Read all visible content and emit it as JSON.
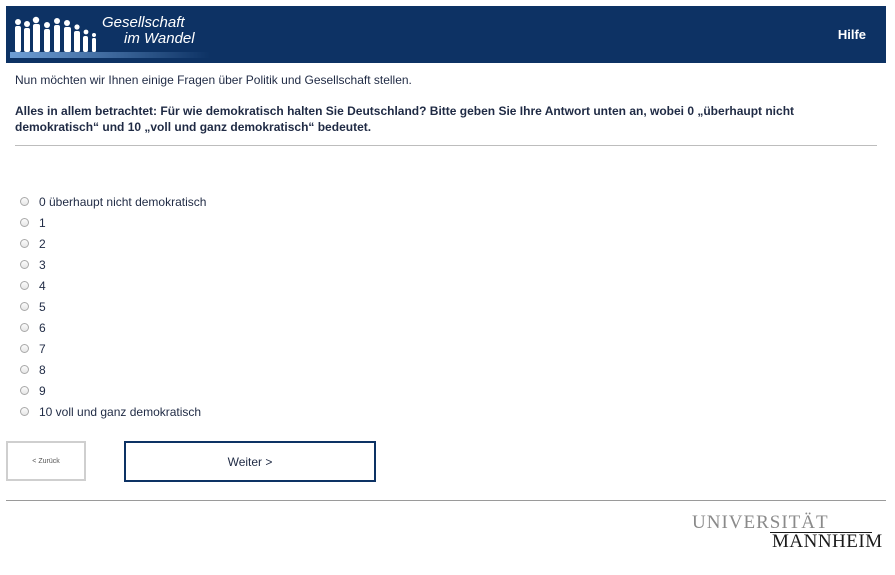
{
  "header": {
    "logo_line1": "Gesellschaft",
    "logo_line2": "im Wandel",
    "help_label": "Hilfe",
    "background_color": "#0d3264"
  },
  "intro_text": "Nun möchten wir Ihnen einige Fragen über Politik und Gesellschaft stellen.",
  "question_text": "Alles in allem betrachtet: Für wie demokratisch halten Sie Deutschland? Bitte geben Sie Ihre Antwort unten an, wobei 0 „überhaupt nicht demokratisch“ und 10 „voll und ganz demokratisch“ bedeutet.",
  "options": [
    {
      "label": "0 überhaupt nicht demokratisch"
    },
    {
      "label": "1"
    },
    {
      "label": "2"
    },
    {
      "label": "3"
    },
    {
      "label": "4"
    },
    {
      "label": "5"
    },
    {
      "label": "6"
    },
    {
      "label": "7"
    },
    {
      "label": "8"
    },
    {
      "label": "9"
    },
    {
      "label": "10 voll und ganz demokratisch"
    }
  ],
  "buttons": {
    "back_label": "< Zurück",
    "next_label": "Weiter >"
  },
  "footer": {
    "university_line1": "UNIVERSITÄT",
    "university_line2": "MANNHEIM"
  }
}
